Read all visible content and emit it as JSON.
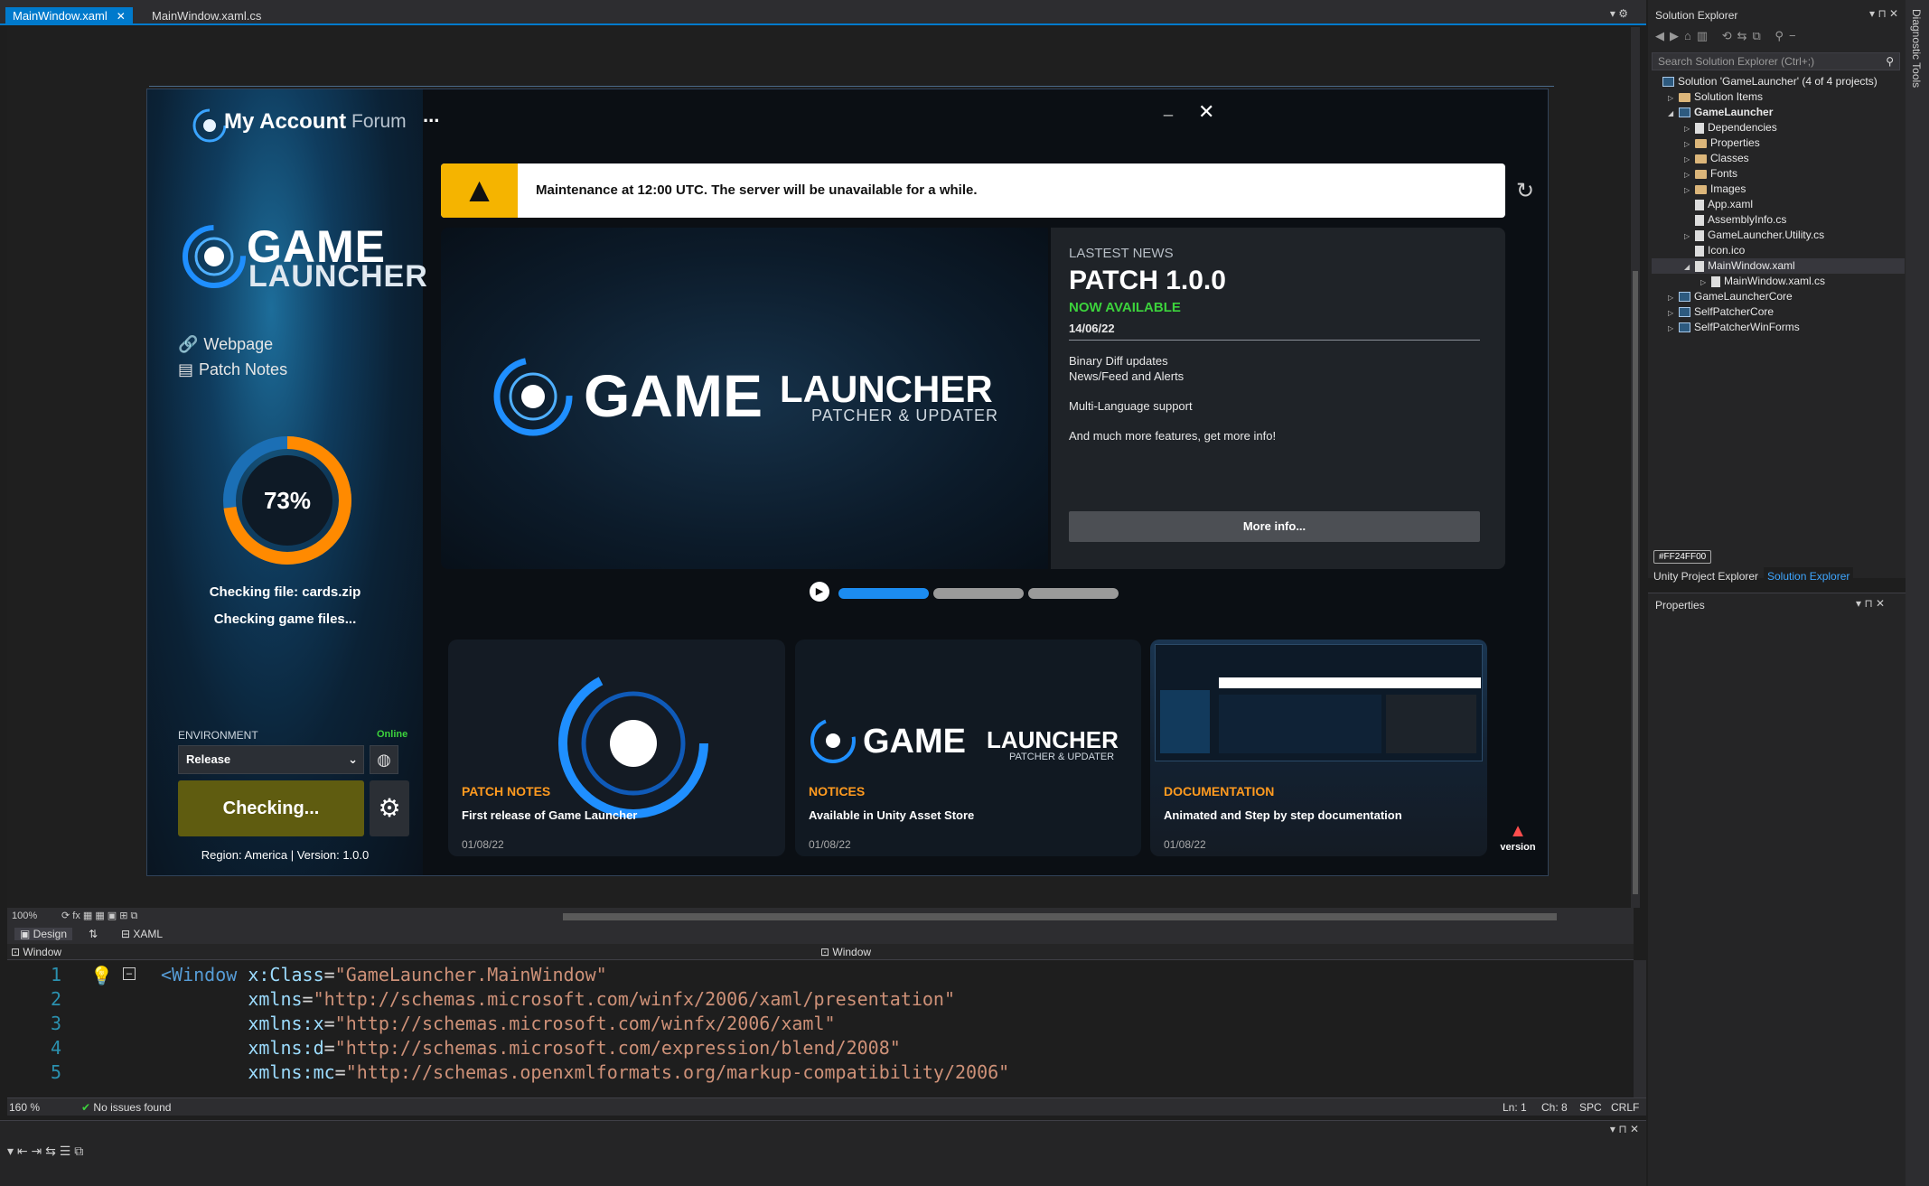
{
  "tabs": [
    {
      "label": "MainWindow.xaml",
      "active": true
    },
    {
      "label": "MainWindow.xaml.cs",
      "active": false
    }
  ],
  "launcher": {
    "nav": {
      "my_account": "My Account",
      "forum": "Forum",
      "more": "..."
    },
    "window_controls": {
      "minimize": "_",
      "close": "✕"
    },
    "logo": {
      "line1": "GAME",
      "line2": "LAUNCHER"
    },
    "links": [
      {
        "label": "Webpage",
        "icon": "link-icon"
      },
      {
        "label": "Patch Notes",
        "icon": "notes-icon"
      }
    ],
    "progress": {
      "percent_label": "73%",
      "value": 0.73,
      "file": "Checking file: cards.zip",
      "status": "Checking game files..."
    },
    "environment": {
      "label": "ENVIRONMENT",
      "status": "Online",
      "selected": "Release",
      "button": "Checking...",
      "region": "Region: America | Version: 1.0.0"
    },
    "alert": {
      "text": "Maintenance at 12:00 UTC. The server will be unavailable for a while."
    },
    "hero": {
      "big": "GAME",
      "small": "LAUNCHER",
      "tagline": "PATCHER & UPDATER"
    },
    "news": {
      "kicker": "LASTEST NEWS",
      "title": "PATCH 1.0.0",
      "subtitle": "NOW AVAILABLE",
      "date": "14/06/22",
      "lines": [
        "Binary Diff updates",
        "News/Feed and Alerts",
        "Multi-Language support",
        "And much more features, get more info!"
      ],
      "button": "More info..."
    },
    "cards": [
      {
        "tag": "PATCH NOTES",
        "title": "First release of Game Launcher",
        "date": "01/08/22"
      },
      {
        "tag": "NOTICES",
        "title": "Available in Unity Asset Store",
        "date": "01/08/22"
      },
      {
        "tag": "DOCUMENTATION",
        "title": "Animated and Step by step documentation",
        "date": "01/08/22"
      }
    ],
    "version_label": "version"
  },
  "designer_bar": {
    "zoom": "100%",
    "design_tab": "Design",
    "xaml_tab": "XAML",
    "breadcrumb_left": "Window",
    "breadcrumb_right": "Window"
  },
  "code": [
    {
      "n": "1",
      "parts": [
        [
          "tg",
          "<Window "
        ],
        [
          "kw",
          "x:Class"
        ],
        [
          "plain",
          "="
        ],
        [
          "st",
          "\"GameLauncher.MainWindow\""
        ]
      ]
    },
    {
      "n": "2",
      "parts": [
        [
          "kw",
          "        xmlns"
        ],
        [
          "plain",
          "="
        ],
        [
          "st",
          "\"http://schemas.microsoft.com/winfx/2006/xaml/presentation\""
        ]
      ]
    },
    {
      "n": "3",
      "parts": [
        [
          "kw",
          "        xmlns:x"
        ],
        [
          "plain",
          "="
        ],
        [
          "st",
          "\"http://schemas.microsoft.com/winfx/2006/xaml\""
        ]
      ]
    },
    {
      "n": "4",
      "parts": [
        [
          "kw",
          "        xmlns:d"
        ],
        [
          "plain",
          "="
        ],
        [
          "st",
          "\"http://schemas.microsoft.com/expression/blend/2008\""
        ]
      ]
    },
    {
      "n": "5",
      "parts": [
        [
          "kw",
          "        xmlns:mc"
        ],
        [
          "plain",
          "="
        ],
        [
          "st",
          "\"http://schemas.openxmlformats.org/markup-compatibility/2006\""
        ]
      ]
    }
  ],
  "status": {
    "zoom": "160 %",
    "issues": "No issues found",
    "ln": "Ln: 1",
    "ch": "Ch: 8",
    "spc": "SPC",
    "crlf": "CRLF"
  },
  "solution_explorer": {
    "title": "Solution Explorer",
    "search": "Search Solution Explorer (Ctrl+;)",
    "items": [
      {
        "label": "Solution 'GameLauncher' (4 of 4 projects)",
        "indent": 0,
        "icon": "solution",
        "tri": ""
      },
      {
        "label": "Solution Items",
        "indent": 1,
        "icon": "folder",
        "tri": "▷"
      },
      {
        "label": "GameLauncher",
        "indent": 1,
        "icon": "project",
        "tri": "◢"
      },
      {
        "label": "Dependencies",
        "indent": 2,
        "icon": "dep",
        "tri": "▷"
      },
      {
        "label": "Properties",
        "indent": 2,
        "icon": "folder",
        "tri": "▷"
      },
      {
        "label": "Classes",
        "indent": 2,
        "icon": "folder",
        "tri": "▷"
      },
      {
        "label": "Fonts",
        "indent": 2,
        "icon": "folder",
        "tri": "▷"
      },
      {
        "label": "Images",
        "indent": 2,
        "icon": "folder",
        "tri": "▷"
      },
      {
        "label": "App.xaml",
        "indent": 2,
        "icon": "file",
        "tri": ""
      },
      {
        "label": "AssemblyInfo.cs",
        "indent": 2,
        "icon": "file",
        "tri": ""
      },
      {
        "label": "GameLauncher.Utility.cs",
        "indent": 2,
        "icon": "file",
        "tri": "▷"
      },
      {
        "label": "Icon.ico",
        "indent": 2,
        "icon": "file",
        "tri": ""
      },
      {
        "label": "MainWindow.xaml",
        "indent": 2,
        "icon": "file",
        "tri": "◢"
      },
      {
        "label": "MainWindow.xaml.cs",
        "indent": 3,
        "icon": "file",
        "tri": "▷"
      },
      {
        "label": "GameLauncherCore",
        "indent": 1,
        "icon": "project",
        "tri": "▷"
      },
      {
        "label": "SelfPatcherCore",
        "indent": 1,
        "icon": "project",
        "tri": "▷"
      },
      {
        "label": "SelfPatcherWinForms",
        "indent": 1,
        "icon": "project",
        "tri": "▷"
      }
    ],
    "color_chip": "#FF24FF00",
    "bottom_tabs": [
      "Unity Project Explorer",
      "Solution Explorer"
    ],
    "properties_title": "Properties",
    "side_tab": "Diagnostic Tools"
  },
  "colors": {
    "accent": "#007acc",
    "alert_yellow": "#f5b400",
    "online_green": "#3cd23c",
    "checking_btn": "#5f5c10",
    "progress_orange": "#ff7a00"
  }
}
